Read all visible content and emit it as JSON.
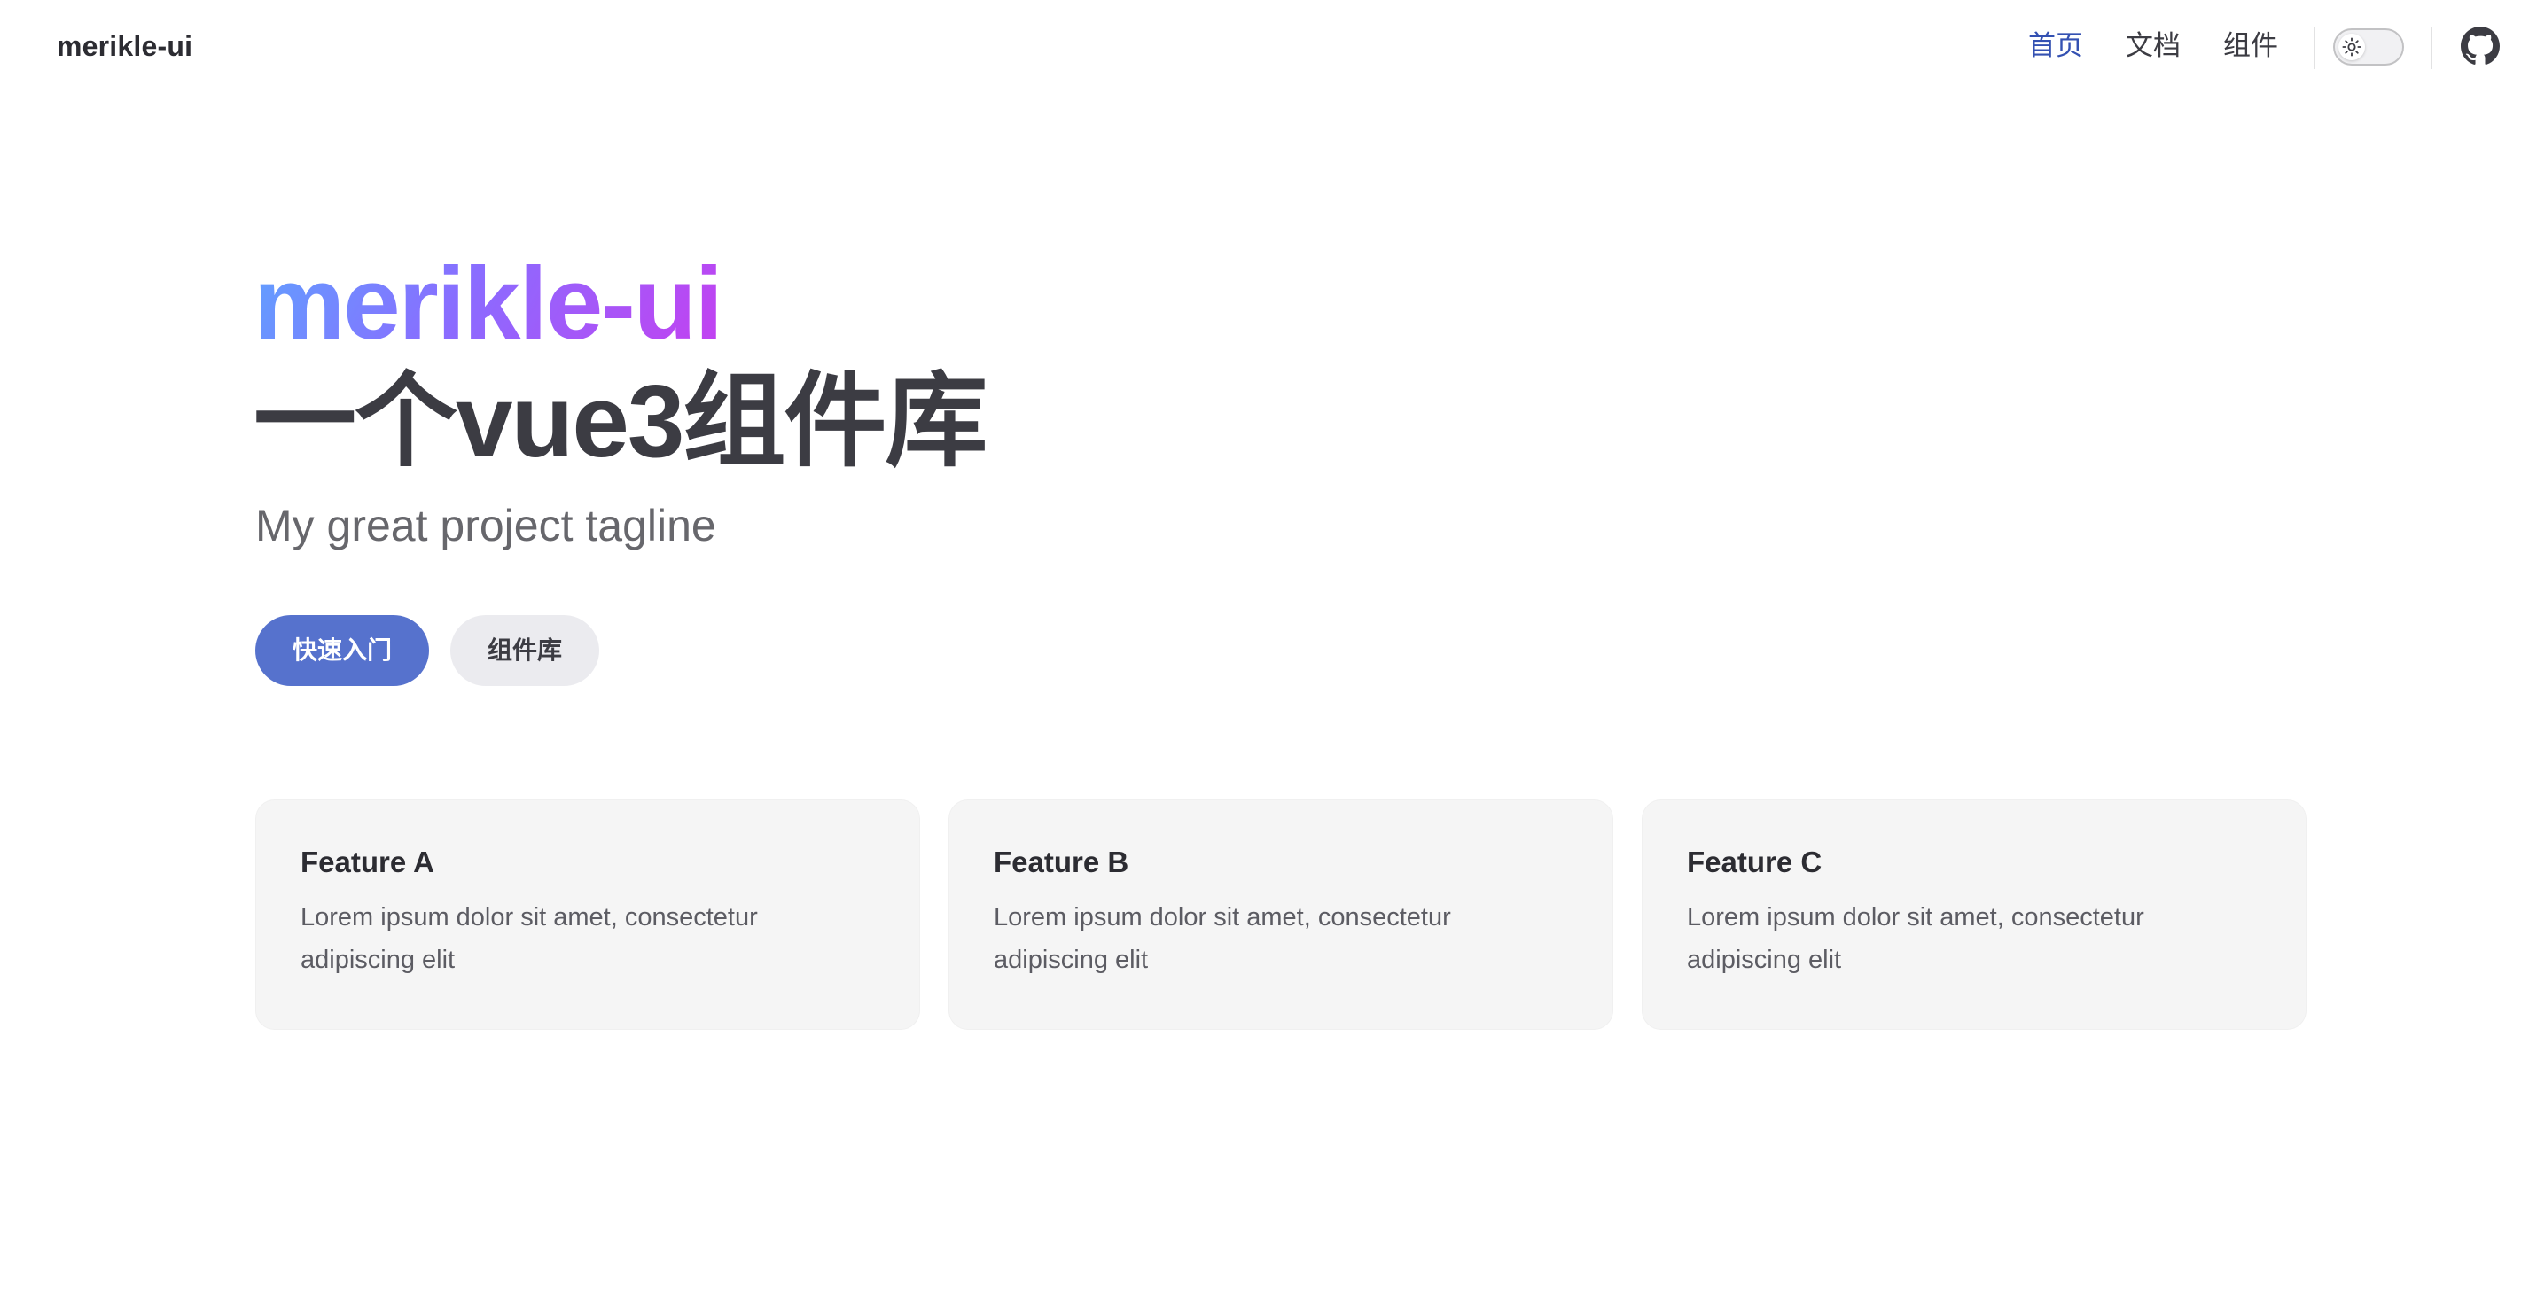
{
  "nav": {
    "brand": "merikle-ui",
    "links": [
      {
        "label": "首页",
        "active": true
      },
      {
        "label": "文档",
        "active": false
      },
      {
        "label": "组件",
        "active": false
      }
    ],
    "theme_toggle_icon": "sun-icon",
    "social_icon": "github-icon",
    "active_color": "#3451b2"
  },
  "hero": {
    "name": "merikle-ui",
    "text": "一个vue3组件库",
    "tagline": "My great project tagline",
    "actions": [
      {
        "label": "快速入门",
        "theme": "brand",
        "color": "#5672cd"
      },
      {
        "label": "组件库",
        "theme": "alt",
        "color": "#ebebef"
      }
    ],
    "name_gradient": [
      "#5fa2ff",
      "#c53ff0"
    ]
  },
  "features": [
    {
      "title": "Feature A",
      "details": "Lorem ipsum dolor sit amet, consectetur adipiscing elit"
    },
    {
      "title": "Feature B",
      "details": "Lorem ipsum dolor sit amet, consectetur adipiscing elit"
    },
    {
      "title": "Feature C",
      "details": "Lorem ipsum dolor sit amet, consectetur adipiscing elit"
    }
  ]
}
